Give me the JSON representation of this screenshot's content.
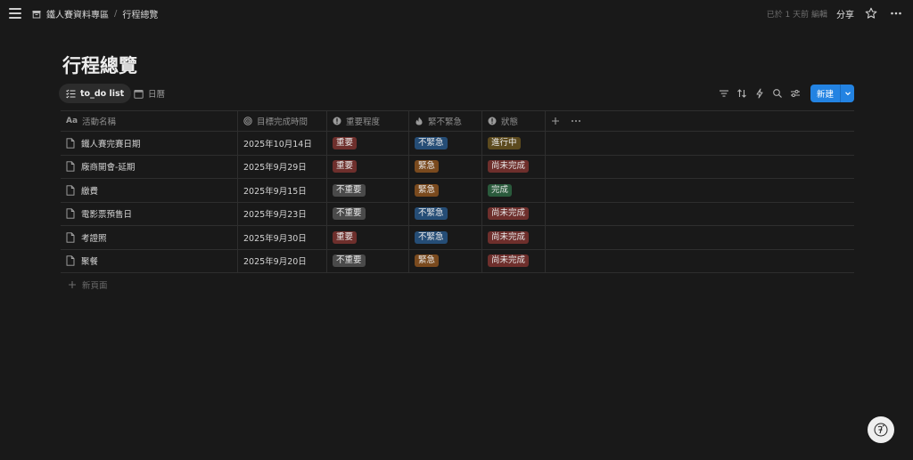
{
  "breadcrumb": {
    "workspace": "鐵人賽資料專區",
    "separator": "/",
    "page": "行程總覽"
  },
  "topbar": {
    "edited": "已於 1 天前 編輯",
    "share": "分享"
  },
  "page_title": "行程總覽",
  "views": [
    {
      "label": "to_do list"
    },
    {
      "label": "日曆"
    }
  ],
  "new_button": {
    "label": "新建"
  },
  "columns": [
    {
      "label": "活動名稱",
      "prefix": "Aa"
    },
    {
      "label": "目標完成時間"
    },
    {
      "label": "重要程度"
    },
    {
      "label": "緊不緊急"
    },
    {
      "label": "狀態"
    }
  ],
  "rows": [
    {
      "name": "鐵人賽完賽日期",
      "date": "2025年10月14日",
      "importance": "重要",
      "urgency": "不緊急",
      "status": "進行中"
    },
    {
      "name": "廠商開會-延期",
      "date": "2025年9月29日",
      "importance": "重要",
      "urgency": "緊急",
      "status": "尚未完成"
    },
    {
      "name": "繳費",
      "date": "2025年9月15日",
      "importance": "不重要",
      "urgency": "緊急",
      "status": "完成"
    },
    {
      "name": "電影票預售日",
      "date": "2025年9月23日",
      "importance": "不重要",
      "urgency": "不緊急",
      "status": "尚未完成"
    },
    {
      "name": "考證照",
      "date": "2025年9月30日",
      "importance": "重要",
      "urgency": "不緊急",
      "status": "尚未完成"
    },
    {
      "name": "聚餐",
      "date": "2025年9月20日",
      "importance": "不重要",
      "urgency": "緊急",
      "status": "尚未完成"
    }
  ],
  "new_page": "新頁面",
  "tag_colors": {
    "重要": "#6e2f2c",
    "不重要": "#4a4a4a",
    "緊急": "#7a4a1e",
    "不緊急": "#254d76",
    "進行中": "#5c4a1e",
    "尚未完成": "#6e2f2c",
    "完成": "#2a5a3c"
  },
  "accent": "#2383e2"
}
